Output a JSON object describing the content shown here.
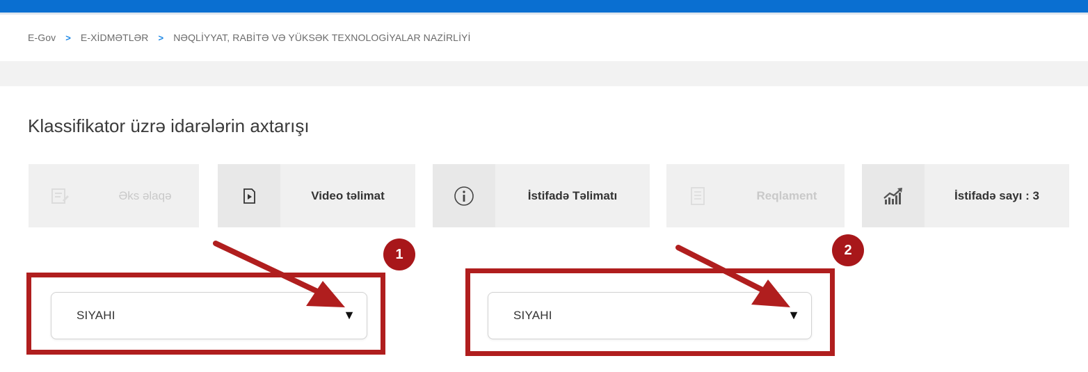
{
  "breadcrumb": {
    "items": [
      "E-Gov",
      "E-XİDMƏTLƏR",
      "NƏQLİYYAT, RABİTƏ VƏ YÜKSƏK TEXNOLOGİYALAR NAZİRLİYİ"
    ],
    "separator": ">"
  },
  "page_title": "Klassifikator üzrə idarələrin axtarışı",
  "actions": [
    {
      "label": "Əks əlaqə",
      "icon": "feedback-icon",
      "enabled": false
    },
    {
      "label": "Video təlimat",
      "icon": "video-play-icon",
      "enabled": true
    },
    {
      "label": "İstifadə Təlimatı",
      "icon": "info-icon",
      "enabled": true
    },
    {
      "label": "Reqlament",
      "icon": "document-icon",
      "enabled": false
    },
    {
      "label": "İstifadə sayı : 3",
      "icon": "chart-growth-icon",
      "enabled": true
    }
  ],
  "selects": [
    {
      "value": "SIYAHI"
    },
    {
      "value": "SIYAHI"
    }
  ],
  "annotations": {
    "badge_1": "1",
    "badge_2": "2"
  },
  "colors": {
    "top_bar": "#0a6fd1",
    "breadcrumb_separator": "#1e88e5",
    "annotation_red": "#b01e1e",
    "badge_red": "#a8171a"
  }
}
